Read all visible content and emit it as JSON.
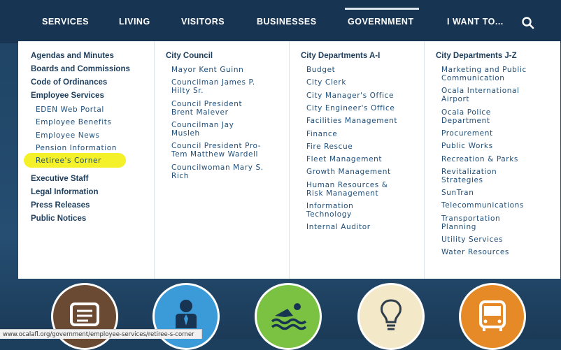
{
  "nav": {
    "items": [
      "SERVICES",
      "LIVING",
      "VISITORS",
      "BUSINESSES",
      "GOVERNMENT",
      "I WANT TO..."
    ],
    "active": "GOVERNMENT"
  },
  "col1": {
    "top_links": [
      "Agendas and Minutes",
      "Boards and Commissions",
      "Code of Ordinances",
      "Employee Services"
    ],
    "sub_links": [
      "EDEN Web Portal",
      "Employee Benefits",
      "Employee News",
      "Pension Information",
      "Retiree's Corner"
    ],
    "bottom_links": [
      "Executive Staff",
      "Legal Information",
      "Press Releases",
      "Public Notices"
    ]
  },
  "col2": {
    "heading": "City Council",
    "links": [
      [
        "Mayor Kent Guinn"
      ],
      [
        "Councilman James P.",
        "Hilty Sr."
      ],
      [
        "Council President",
        "Brent Malever"
      ],
      [
        "Councilman Jay",
        "Musleh"
      ],
      [
        "Council President Pro-",
        "Tem Matthew Wardell"
      ],
      [
        "Councilwoman Mary S.",
        "Rich"
      ]
    ]
  },
  "col3": {
    "heading": "City Departments A-I",
    "links": [
      [
        "Budget"
      ],
      [
        "City Clerk"
      ],
      [
        "City Manager's Office"
      ],
      [
        "City Engineer's Office"
      ],
      [
        "Facilities Management"
      ],
      [
        "Finance"
      ],
      [
        "Fire Rescue"
      ],
      [
        "Fleet Management"
      ],
      [
        "Growth Management"
      ],
      [
        "Human Resources &",
        "Risk Management"
      ],
      [
        "Information",
        "Technology"
      ],
      [
        "Internal Auditor"
      ]
    ]
  },
  "col4": {
    "heading": "City Departments J-Z",
    "links": [
      [
        "Marketing and Public",
        "Communication"
      ],
      [
        "Ocala International",
        "Airport"
      ],
      [
        "Ocala Police",
        "Department"
      ],
      [
        "Procurement"
      ],
      [
        "Public Works"
      ],
      [
        "Recreation & Parks"
      ],
      [
        "Revitalization",
        "Strategies"
      ],
      [
        "SunTran"
      ],
      [
        "Telecommunications"
      ],
      [
        "Transportation",
        "Planning"
      ],
      [
        "Utility Services"
      ],
      [
        "Water Resources"
      ]
    ]
  },
  "status_url": "www.ocalafl.org/government/employee-services/retiree-s-corner",
  "colors": {
    "nav_bg": "#173552",
    "heading": "#1d3d5c",
    "link": "#1f4f7a",
    "highlight": "#f4f02a",
    "circle_brown": "#6b4a34",
    "circle_blue": "#3b9ad8",
    "circle_green": "#7cc242",
    "circle_cream": "#f3e8c8",
    "circle_orange": "#e58a26"
  },
  "icons": [
    "document-icon",
    "person-icon",
    "swimmer-icon",
    "lightbulb-icon",
    "bus-icon",
    "search-icon"
  ]
}
